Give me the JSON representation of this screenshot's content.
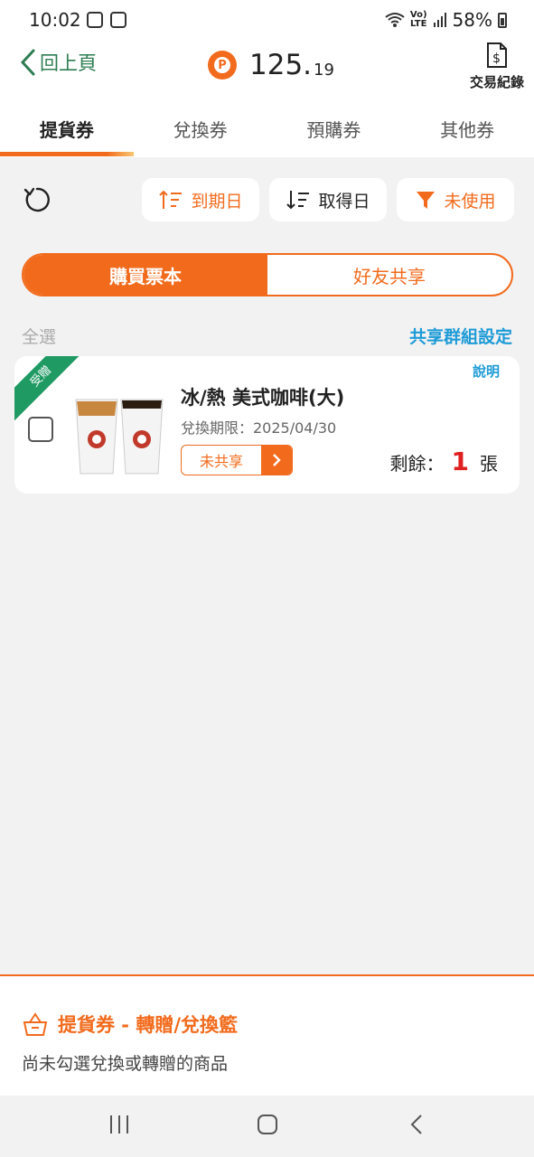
{
  "status_bar": {
    "time": "10:02",
    "battery": "58%",
    "volte": "Vo)",
    "lte": "LTE"
  },
  "header": {
    "back_label": "回上頁",
    "points_integer": "125.",
    "points_decimal": "19",
    "points_badge": "P",
    "transactions_label": "交易紀錄"
  },
  "tabs": [
    {
      "label": "提貨券",
      "active": true
    },
    {
      "label": "兌換券",
      "active": false
    },
    {
      "label": "預購券",
      "active": false
    },
    {
      "label": "其他券",
      "active": false
    }
  ],
  "filters": {
    "expiry": "到期日",
    "acquired": "取得日",
    "unused": "未使用"
  },
  "segment": {
    "buy": "購買票本",
    "share": "好友共享"
  },
  "list_controls": {
    "select_all": "全選",
    "share_group_settings": "共享群組設定"
  },
  "items": [
    {
      "ribbon": "受贈",
      "explain": "說明",
      "title": "冰/熱 美式咖啡(大)",
      "expiry": "兌換期限：2025/04/30",
      "share_status": "未共享",
      "remaining_label": "剩餘：",
      "remaining_count": "1",
      "remaining_unit": "張"
    }
  ],
  "bottom_panel": {
    "title": "提貨券 - 轉贈/兌換籃",
    "subtitle": "尚未勾選兌換或轉贈的商品"
  },
  "colors": {
    "accent": "#f26b1d",
    "brand_green": "#2e7d52",
    "link_blue": "#1e9bd7",
    "remaining_red": "#e02020"
  }
}
